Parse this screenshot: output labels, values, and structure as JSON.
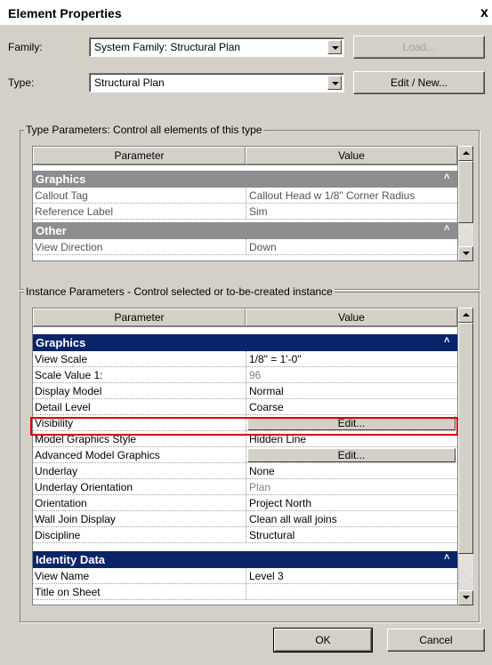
{
  "window": {
    "title": "Element Properties",
    "close_glyph": "x"
  },
  "family": {
    "label": "Family:",
    "value": "System Family: Structural Plan",
    "load_button": "Load..."
  },
  "type": {
    "label": "Type:",
    "value": "Structural Plan",
    "edit_new_button": "Edit / New..."
  },
  "type_params": {
    "group_title": "Type Parameters: Control all elements of this type",
    "col_parameter": "Parameter",
    "col_value": "Value",
    "categories": [
      {
        "name": "Graphics",
        "rows": [
          {
            "param": "Callout Tag",
            "value": "Callout Head w 1/8\" Corner Radius"
          },
          {
            "param": "Reference Label",
            "value": "Sim"
          }
        ]
      },
      {
        "name": "Other",
        "rows": [
          {
            "param": "View Direction",
            "value": "Down"
          }
        ]
      }
    ]
  },
  "instance_params": {
    "group_title": "Instance Parameters - Control selected or to-be-created instance",
    "col_parameter": "Parameter",
    "col_value": "Value",
    "graphics_category": "Graphics",
    "rows": [
      {
        "param": "View Scale",
        "value": "1/8\" = 1'-0\""
      },
      {
        "param": "Scale Value    1:",
        "value": "96"
      },
      {
        "param": "Display Model",
        "value": "Normal"
      },
      {
        "param": "Detail Level",
        "value": "Coarse"
      },
      {
        "param": "Visibility",
        "value": "Edit..."
      },
      {
        "param": "Model Graphics Style",
        "value": "Hidden Line"
      },
      {
        "param": "Advanced Model Graphics",
        "value": "Edit..."
      },
      {
        "param": "Underlay",
        "value": "None"
      },
      {
        "param": "Underlay Orientation",
        "value": "Plan"
      },
      {
        "param": "Orientation",
        "value": "Project North"
      },
      {
        "param": "Wall Join Display",
        "value": "Clean all wall joins"
      },
      {
        "param": "Discipline",
        "value": "Structural"
      }
    ],
    "identity_category": "Identity Data",
    "identity_rows": [
      {
        "param": "View Name",
        "value": "Level 3"
      },
      {
        "param": "Title on Sheet",
        "value": ""
      }
    ]
  },
  "buttons": {
    "ok": "OK",
    "cancel": "Cancel"
  },
  "colors": {
    "category_type": "#8d8d8d",
    "category_instance": "#0a246a",
    "highlight": "#e00000"
  }
}
